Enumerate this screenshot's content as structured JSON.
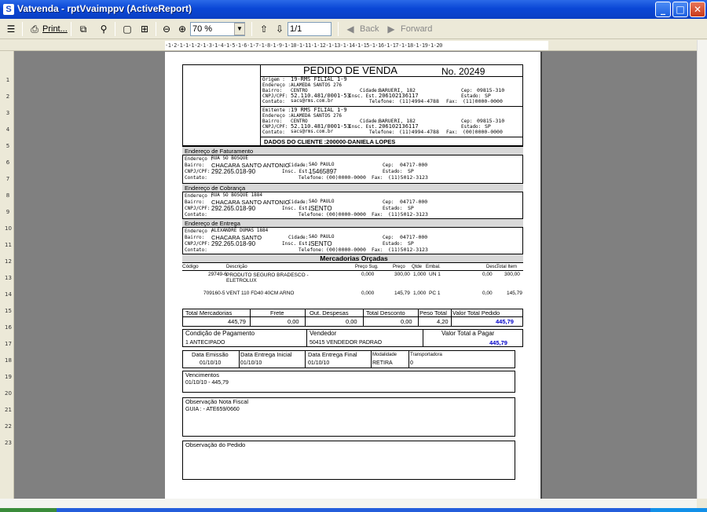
{
  "window": {
    "title": "Vatvenda - rptVvaimppv (ActiveReport)",
    "min": "_",
    "max": "□",
    "close": "✕"
  },
  "toolbar": {
    "print": "Print...",
    "zoom": "70 %",
    "page": "1/1",
    "back": "Back",
    "forward": "Forward"
  },
  "ruler": {
    "h": "·1·2·1·1·1·2·1·3·1·4·1·5·1·6·1·7·1·8·1·9·1·10·1·11·1·12·1·13·1·14·1·15·1·16·1·17·1·18·1·19·1·20",
    "v": [
      "1",
      "2",
      "3",
      "4",
      "5",
      "6",
      "7",
      "8",
      "9",
      "10",
      "11",
      "12",
      "13",
      "14",
      "15",
      "16",
      "17",
      "18",
      "19",
      "20",
      "21",
      "22",
      "23"
    ]
  },
  "report": {
    "title": "PEDIDO DE VENDA",
    "number": "No.  20249",
    "origem": {
      "l1": "Origem :",
      "v1": "19-RMS FILIAL 1-9",
      "l2": "Endereço :",
      "v2": "ALAMEDA SANTOS 276",
      "l3": "Bairro:",
      "v3": "CENTRO",
      "l4": "CNPJ/CPF:",
      "v4": "52.110.481/0001-53",
      "l5": "Contato:",
      "v5": "sacs@rms.com.br",
      "cidade_l": "Cidade:",
      "cidade": "BARUERI, 182",
      "cep_l": "Cep:",
      "cep": "09815-310",
      "insc_l": "Insc. Est.",
      "insc": "206102136117",
      "estado_l": "Estado:",
      "estado": "SP",
      "tel_l": "Telefone:",
      "tel": "(11)4994-4788",
      "fax_l": "Fax:",
      "fax": "(11)0000-0000"
    },
    "emitente": {
      "l1": "Emitente :",
      "v1": "19 RMS FILIAL 1-9",
      "l2": "Endereço :",
      "v2": "ALAMEDA SANTOS 276",
      "l3": "Bairro:",
      "v3": "CENTRO",
      "l4": "CNPJ/CPF:",
      "v4": "52.110.481/0001-53",
      "l5": "Contato:",
      "v5": "sacs@rms.com.br",
      "cidade_l": "Cidade:",
      "cidade": "BARUERI, 182",
      "cep_l": "Cep:",
      "cep": "09815-310",
      "insc_l": "Insc. Est.",
      "insc": "206102136117",
      "estado_l": "Estado:",
      "estado": "SP",
      "tel_l": "Telefone:",
      "tel": "(11)4994-4788",
      "fax_l": "Fax:",
      "fax": "(00)0000-0000"
    },
    "dados_cliente": "DADOS DO CLIENTE :200000-DANIELA LOPES",
    "faturamento": {
      "header": "Endereço de Faturamento",
      "end_l": "Endereço :",
      "end": "RUA SO BOSQUE",
      "bairro_l": "Bairro:",
      "bairro": "CHACARA SANTO ANTONIO",
      "cnpj_l": "CNPJ/CPF:",
      "cnpj": "292.265.018-90",
      "contato_l": "Contato:",
      "cidade_l": "Cidade:",
      "cidade": "SAO PAULO",
      "insc_l": "Insc. Est.",
      "insc": "15465897",
      "tel_l": "Telefone:",
      "tel": "(00)0000-0000",
      "cep_l": "Cep:",
      "cep": "04717-000",
      "estado_l": "Estado:",
      "estado": "SP",
      "fax_l": "Fax:",
      "fax": "(11)5012-3123"
    },
    "cobranca": {
      "header": "Endereço de Cobrança",
      "end_l": "Endereço :",
      "end": "RUA SO BOSQUE 1884",
      "bairro_l": "Bairro:",
      "bairro": "CHACARA SANTO ANTONIO",
      "cnpj_l": "CNPJ/CPF:",
      "cnpj": "292.265.018-90",
      "contato_l": "Contato:",
      "cidade_l": "Cidade:",
      "cidade": "SAO PAULO",
      "insc_l": "Insc. Est.",
      "insc": "ISENTO",
      "tel_l": "Telefone:",
      "tel": "(00)0000-0000",
      "cep_l": "Cep:",
      "cep": "04717-000",
      "estado_l": "Estado:",
      "estado": "SP",
      "fax_l": "Fax:",
      "fax": "(11)5012-3123"
    },
    "entrega": {
      "header": "Endereço de Entrega",
      "end_l": "Endereço :",
      "end": "ALEXANDRE DUMAS 1884",
      "bairro_l": "Bairro:",
      "bairro": "CHACARA SANTO",
      "cnpj_l": "CNPJ/CPF:",
      "cnpj": "292.265.018-90",
      "contato_l": "Contato:",
      "cidade_l": "Cidade:",
      "cidade": "SAO PAULO",
      "insc_l": "Insc. Est.",
      "insc": "ISENTO",
      "tel_l": "Telefone:",
      "tel": "(00)0000-0000",
      "cep_l": "Cep:",
      "cep": "04717-000",
      "estado_l": "Estado:",
      "estado": "SP",
      "fax_l": "Fax:",
      "fax": "(11)5012-3123"
    },
    "mercadorias": {
      "header": "Mercadorias Orçadas",
      "cols": [
        "Código",
        "Descrição",
        "Preço Sug.",
        "Preço",
        "Qtde",
        "Embal.",
        "Desc.",
        "Total Item"
      ],
      "rows": [
        [
          "29749-6",
          "PRODUTO SEGURO BRADESCO - ELETROLUX",
          "0,000",
          "300,00",
          "1,000",
          "UN 1",
          "0,00",
          "300,00"
        ],
        [
          "709160-5",
          "VENT 110 FD40 40CM ARNO",
          "0,000",
          "145,79",
          "1,000",
          "PC 1",
          "0,00",
          "145,79"
        ]
      ]
    },
    "totais": {
      "merc_l": "Total Mercadorias",
      "merc": "445,79",
      "frete_l": "Frete",
      "frete": "0,00",
      "outras_l": "Out. Despesas",
      "outras": "0,00",
      "desc_l": "Total Desconto",
      "desc": "0,00",
      "peso_l": "Peso Total",
      "peso": "4,20",
      "valor_l": "Valor Total Pedido",
      "valor": "445,79"
    },
    "pagamento": {
      "cond_l": "Condição de Pagamento",
      "cond": "1 ANTECIPADO",
      "vend_l": "Vendedor",
      "vend": "50415 VENDEDOR PADRAO",
      "pagar_l": "Valor Total a Pagar",
      "pagar": "445,79"
    },
    "datas": {
      "emissao_l": "Data Emissão",
      "emissao": "01/10/10",
      "ini_l": "Data Entrega Inicial",
      "ini": "01/10/10",
      "fim_l": "Data Entrega Final",
      "fim": "01/10/10",
      "mod_l": "Modalidade",
      "mod": "RETIRA",
      "transp_l": "Transportadora",
      "transp": "0"
    },
    "vencimentos": {
      "label": "Vencimentos",
      "value": "01/10/10 - 445,79"
    },
    "obs_fiscal": {
      "label": "Observação Nota Fiscal",
      "value": "GUIA : - ATE659/0660"
    },
    "obs_pedido": {
      "label": "Observação do Pedido"
    }
  }
}
